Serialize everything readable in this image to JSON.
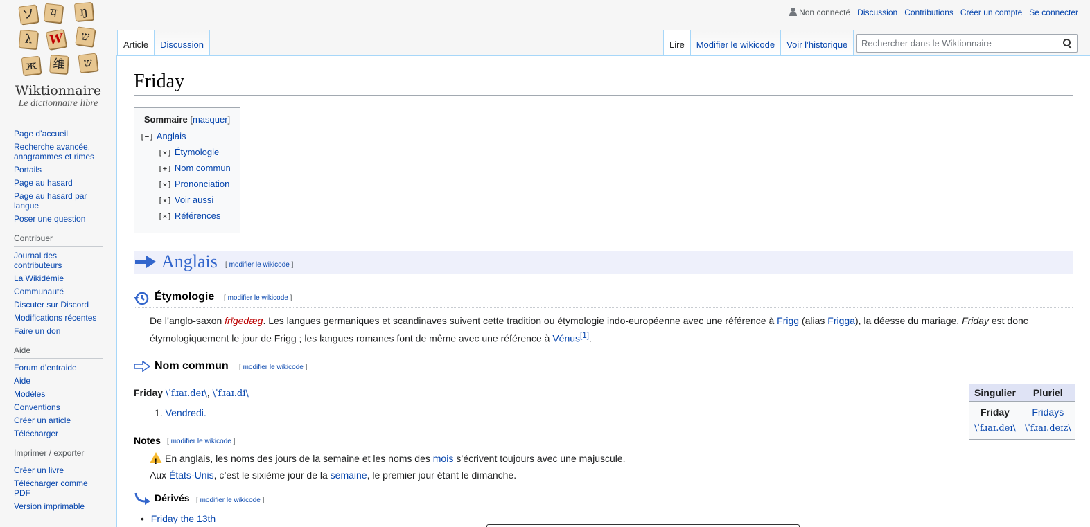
{
  "logo": {
    "tiles": [
      "ソ",
      "य",
      "ŋ",
      "λ",
      "W",
      "ש",
      "ж",
      "维",
      "ש"
    ],
    "name": "Wiktionnaire",
    "tagline": "Le dictionnaire libre"
  },
  "sidebar": {
    "nav": [
      "Page d’accueil",
      "Recherche avancée, anagrammes et rimes",
      "Portails",
      "Page au hasard",
      "Page au hasard par langue",
      "Poser une question"
    ],
    "contribuer_title": "Contribuer",
    "contribuer": [
      "Journal des contributeurs",
      "La Wikidémie",
      "Communauté",
      "Discuter sur Discord",
      "Modifications récentes",
      "Faire un don"
    ],
    "aide_title": "Aide",
    "aide": [
      "Forum d’entraide",
      "Aide",
      "Modèles",
      "Conventions",
      "Créer un article",
      "Télécharger"
    ],
    "imprimer_title": "Imprimer / exporter",
    "imprimer": [
      "Créer un livre",
      "Télécharger comme PDF",
      "Version imprimable"
    ]
  },
  "personal": {
    "not_logged": "Non connecté",
    "discussion": "Discussion",
    "contributions": "Contributions",
    "create_account": "Créer un compte",
    "login": "Se connecter"
  },
  "tabs": {
    "article": "Article",
    "discussion": "Discussion",
    "read": "Lire",
    "edit": "Modifier le wikicode",
    "history": "Voir l’historique"
  },
  "search": {
    "placeholder": "Rechercher dans le Wiktionnaire"
  },
  "page_title": "Friday",
  "toc": {
    "title": "Sommaire",
    "hide": "masquer",
    "items": [
      {
        "toggle": "[−]",
        "label": "Anglais"
      },
      {
        "toggle": "[×]",
        "label": "Étymologie"
      },
      {
        "toggle": "[+]",
        "label": "Nom commun"
      },
      {
        "toggle": "[×]",
        "label": "Prononciation"
      },
      {
        "toggle": "[×]",
        "label": "Voir aussi"
      },
      {
        "toggle": "[×]",
        "label": "Références"
      }
    ]
  },
  "edit_label": "modifier le wikicode",
  "language": "Anglais",
  "etymology": {
    "title": "Étymologie",
    "t1": "De l’anglo-saxon ",
    "word": "frīgedæg",
    "t2": ". Les langues germaniques et scandinaves suivent cette tradition ou étymologie indo-européenne avec une référence à ",
    "frigg": "Frigg",
    "t3": " (alias ",
    "frigga": "Frigga",
    "t4": "), la déesse du mariage. ",
    "friday": "Friday",
    "t5": " est donc",
    "t6": "étymologiquement le jour de Frigg ; les langues romanes font de même avec une référence à ",
    "venus": "Vénus",
    "ref": "[1]",
    "t7": "."
  },
  "noun": {
    "title": "Nom commun",
    "headword": "Friday",
    "pron1": "\\ˈfɹaɪ.deɪ\\",
    "sep": ", ",
    "pron2": "\\ˈfɹaɪ.di\\",
    "def_num": "1.",
    "def": "Vendredi."
  },
  "inflection": {
    "singular": "Singulier",
    "plural": "Pluriel",
    "sing_form": "Friday",
    "plur_form": "Fridays",
    "sing_pron": "\\ˈfɹaɪ.deɪ\\",
    "plur_pron": "\\ˈfɹaɪ.deɪz\\"
  },
  "notes": {
    "title": "Notes",
    "n1a": "En anglais, les noms des jours de la semaine et les noms des ",
    "n1link": "mois",
    "n1b": " s’écrivent toujours avec une majuscule.",
    "n2a": "Aux ",
    "n2link1": "États-Unis",
    "n2b": ", c’est le sixième jour de la ",
    "n2link2": "semaine",
    "n2c": ", le premier jour étant le dimanche."
  },
  "derived": {
    "title": "Dérivés",
    "items": [
      "Friday the 13th"
    ]
  }
}
